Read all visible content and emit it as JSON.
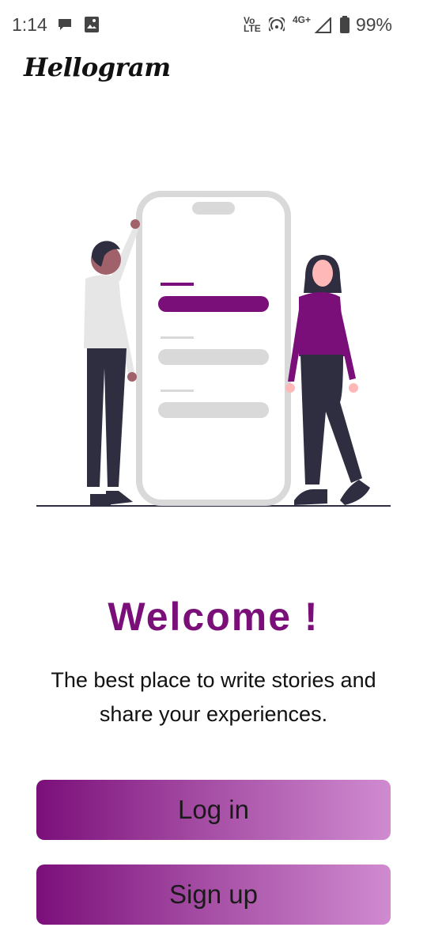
{
  "status_bar": {
    "time": "1:14",
    "network_top": "Vo",
    "network_bottom": "LTE",
    "signal_label": "4G+",
    "battery": "99%"
  },
  "app": {
    "logo_text": "Hellogram"
  },
  "welcome": {
    "title": "Welcome !",
    "subtitle_line1": "The best place to write stories and",
    "subtitle_line2": "share your experiences."
  },
  "buttons": {
    "login_label": "Log in",
    "signup_label": "Sign up"
  },
  "colors": {
    "accent": "#7b0f7a",
    "gradient_end": "#d08bd0",
    "illustration_grey": "#d9d9d9",
    "dark_clothes": "#2f2e41"
  },
  "icons": [
    "chat-bubble-icon",
    "gallery-icon",
    "volte-icon",
    "hotspot-icon",
    "signal-icon",
    "battery-icon"
  ]
}
